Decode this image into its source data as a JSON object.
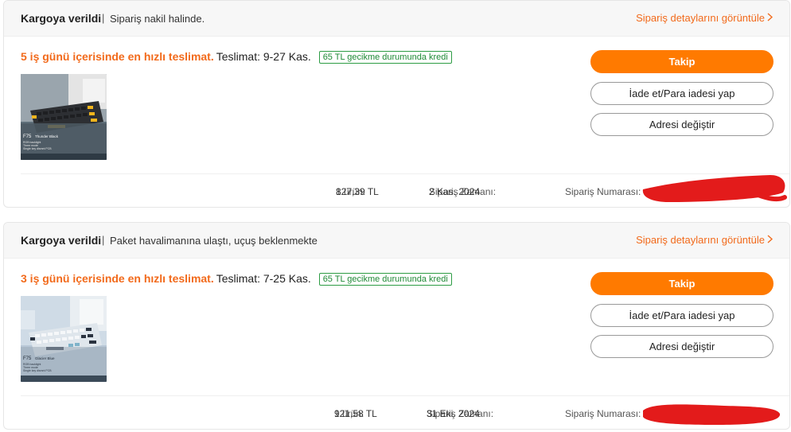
{
  "orders": [
    {
      "status_title": "Kargoya verildi",
      "status_separator": "|",
      "status_desc": "Sipariş nakil halinde.",
      "details_link": "Sipariş detaylarını görüntüle",
      "delivery_fast": "5 iş günü içerisinde en hızlı teslimat.",
      "delivery_window": "Teslimat: 9-27 Kas.",
      "late_credit_badge": "65 TL gecikme durumunda kredi",
      "product_image_alt": "F75 Thunder Black keyboard",
      "product_image_text": {
        "model": "F75",
        "variant": "Thunder Black",
        "line1": "RGB backlight",
        "line2": "Three mode",
        "line3": "Single key dismnt PCB"
      },
      "buttons": {
        "track": "Takip",
        "return_refund": "İade et/Para iadesi yap",
        "change_address": "Adresi değiştir"
      },
      "footer": {
        "item_count_label": "1 ürün:",
        "total": "827,39 TL",
        "order_time_label": "Sipariş Zamanı:",
        "order_time": "2 Kas. 2024",
        "order_number_label": "Sipariş Numarası:"
      }
    },
    {
      "status_title": "Kargoya verildi",
      "status_separator": "|",
      "status_desc": "Paket havalimanına ulaştı, uçuş beklenmekte",
      "details_link": "Sipariş detaylarını görüntüle",
      "delivery_fast": "3 iş günü içerisinde en hızlı teslimat.",
      "delivery_window": "Teslimat: 7-25 Kas.",
      "late_credit_badge": "65 TL gecikme durumunda kredi",
      "product_image_alt": "F75 Glacier Blue keyboard",
      "product_image_text": {
        "model": "F75",
        "variant": "Glacier Blue",
        "line1": "RGB backlight",
        "line2": "Three mode",
        "line3": "Single key dismnt PCB"
      },
      "buttons": {
        "track": "Takip",
        "return_refund": "İade et/Para iadesi yap",
        "change_address": "Adresi değiştir"
      },
      "footer": {
        "item_count_label": "1 ürün:",
        "total": "921,58 TL",
        "order_time_label": "Sipariş Zamanı:",
        "order_time": "31 Eki. 2024",
        "order_number_label": "Sipariş Numarası:"
      }
    }
  ],
  "colors": {
    "accent": "#ff7a00",
    "link": "#f26a1b",
    "badge_green": "#1f8a36",
    "redaction": "#e31b1b"
  },
  "icons": {
    "details_chevron": "chevron-right-icon"
  }
}
